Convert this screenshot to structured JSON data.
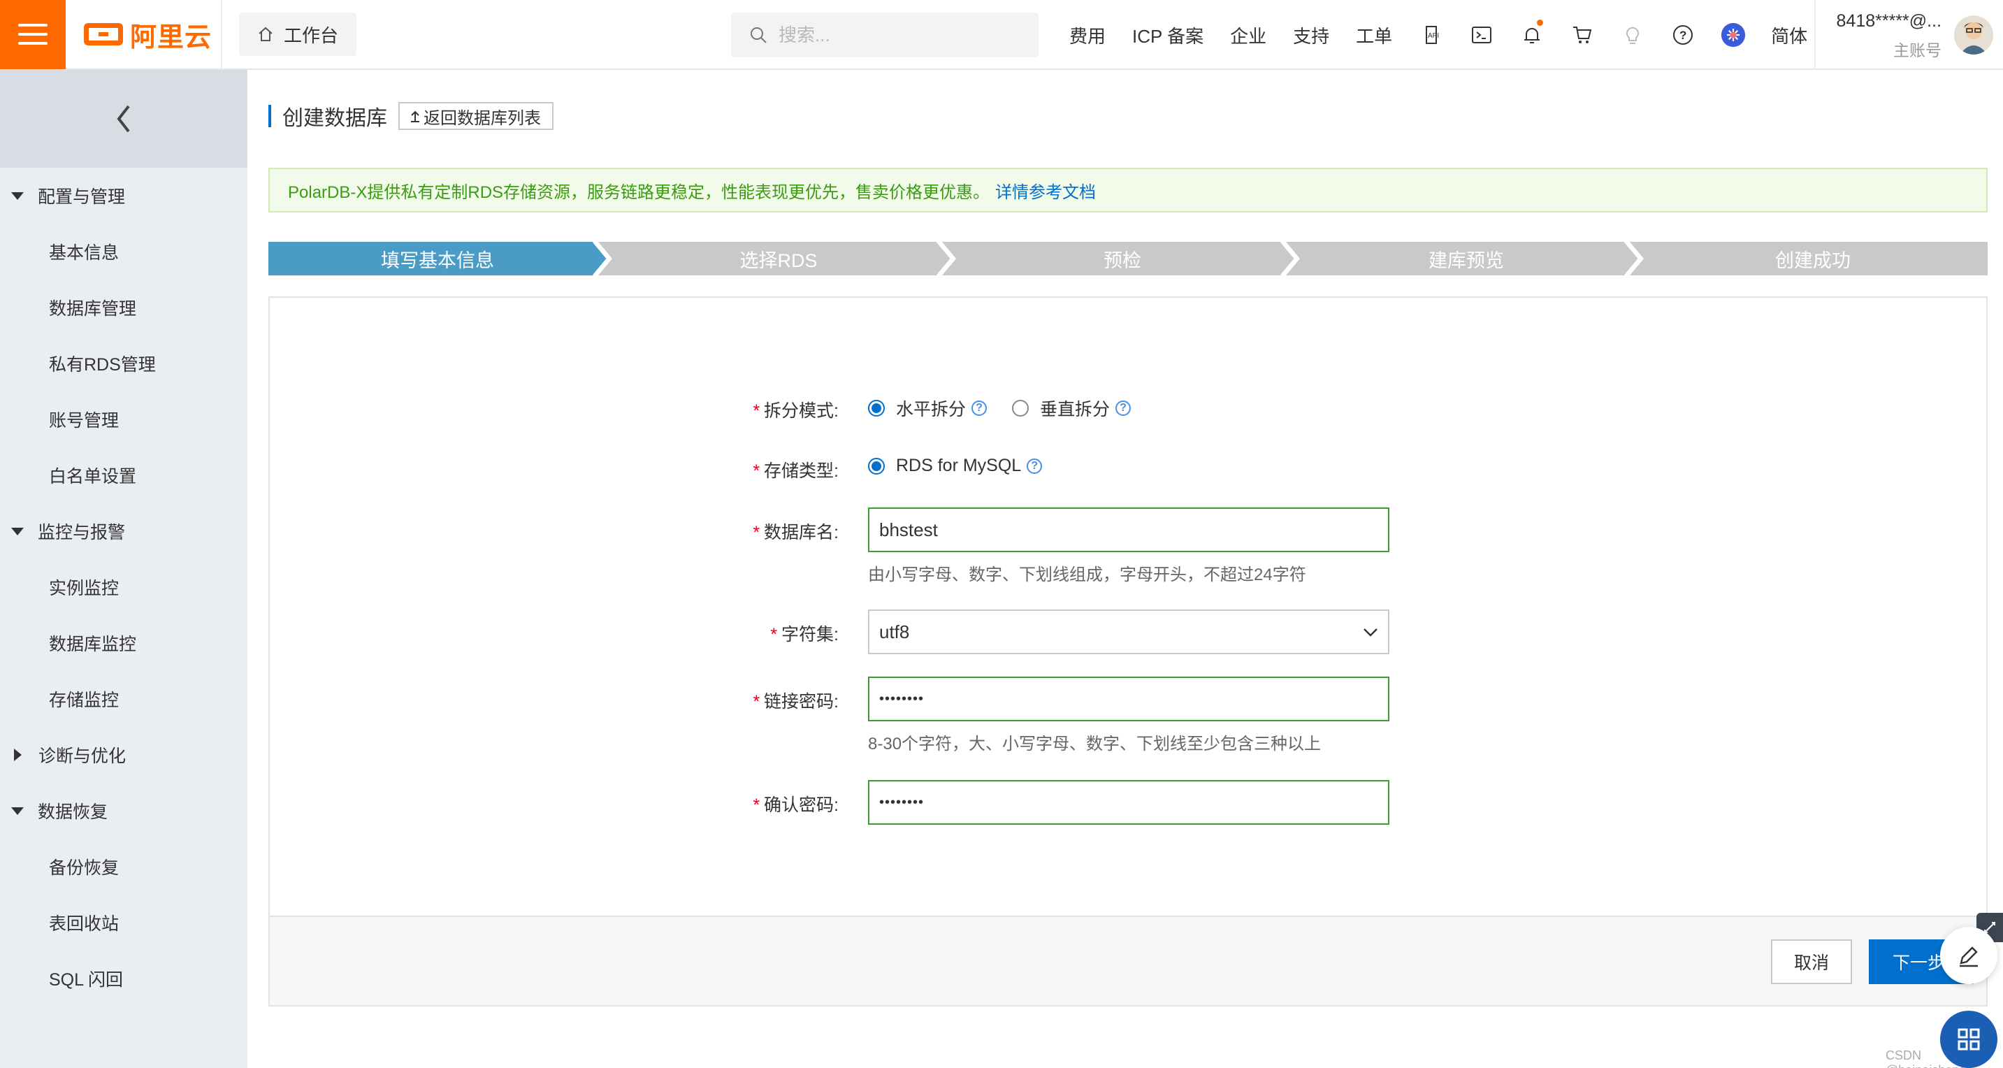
{
  "header": {
    "logo_text": "阿里云",
    "workbench_label": "工作台",
    "search_placeholder": "搜索...",
    "nav": [
      "费用",
      "ICP 备案",
      "企业",
      "支持",
      "工单"
    ],
    "icons": [
      "code-icon",
      "terminal-icon",
      "bell-icon",
      "cart-icon",
      "bulb-icon",
      "help-icon",
      "app-icon"
    ],
    "lang": "简体",
    "account": "8418*****@...",
    "account_role": "主账号",
    "accent_color": "#ff6a00"
  },
  "sidebar": {
    "groups": [
      {
        "label": "配置与管理",
        "expanded": true,
        "items": [
          "基本信息",
          "数据库管理",
          "私有RDS管理",
          "账号管理",
          "白名单设置"
        ]
      },
      {
        "label": "监控与报警",
        "expanded": true,
        "items": [
          "实例监控",
          "数据库监控",
          "存储监控"
        ]
      },
      {
        "label": "诊断与优化",
        "expanded": false,
        "items": []
      },
      {
        "label": "数据恢复",
        "expanded": true,
        "items": [
          "备份恢复",
          "表回收站",
          "SQL 闪回"
        ]
      }
    ]
  },
  "main": {
    "title": "创建数据库",
    "back_button": "返回数据库列表",
    "notice_text": "PolarDB-X提供私有定制RDS存储资源，服务链路更稳定，性能表现更优先，售卖价格更优惠。",
    "notice_link": "详情参考文档",
    "steps": [
      {
        "label": "填写基本信息",
        "active": true
      },
      {
        "label": "选择RDS",
        "active": false
      },
      {
        "label": "预检",
        "active": false
      },
      {
        "label": "建库预览",
        "active": false
      },
      {
        "label": "创建成功",
        "active": false
      }
    ],
    "step_active_color": "#4a9cc7",
    "step_inactive_color": "#c9c9c9",
    "form": {
      "split_mode_label": "拆分模式:",
      "split_options": [
        "水平拆分",
        "垂直拆分"
      ],
      "split_selected": "水平拆分",
      "storage_label": "存储类型:",
      "storage_option": "RDS for MySQL",
      "db_name_label": "数据库名:",
      "db_name_value": "bhstest",
      "db_name_hint": "由小写字母、数字、下划线组成，字母开头，不超过24字符",
      "charset_label": "字符集:",
      "charset_value": "utf8",
      "password_label": "链接密码:",
      "password_value": "••••••••",
      "password_hint": "8-30个字符，大、小写字母、数字、下划线至少包含三种以上",
      "confirm_label": "确认密码:",
      "confirm_value": "••••••••"
    },
    "cancel_button": "取消",
    "next_button": "下一步"
  },
  "watermark": "CSDN @bainaisheng"
}
